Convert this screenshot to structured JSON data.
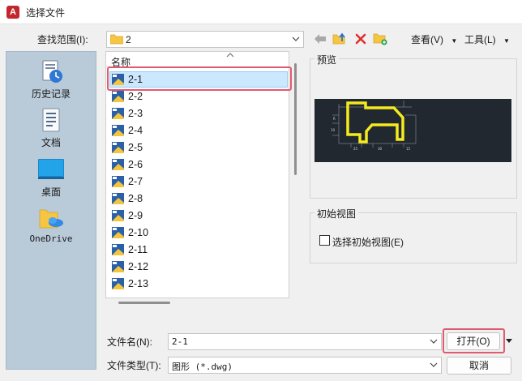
{
  "window": {
    "title": "选择文件",
    "app_icon_letter": "A"
  },
  "lookin": {
    "label": "查找范围(I):",
    "value": "2"
  },
  "toolbar": {
    "view_label": "查看(V)",
    "tools_label": "工具(L)"
  },
  "places": [
    {
      "label": "历史记录",
      "icon": "history-icon"
    },
    {
      "label": "文档",
      "icon": "documents-icon"
    },
    {
      "label": "桌面",
      "icon": "desktop-icon"
    },
    {
      "label": "OneDrive",
      "icon": "onedrive-icon"
    }
  ],
  "filelist": {
    "header": "名称",
    "items": [
      "2-1",
      "2-2",
      "2-3",
      "2-4",
      "2-5",
      "2-6",
      "2-7",
      "2-8",
      "2-9",
      "2-10",
      "2-11",
      "2-12",
      "2-13"
    ],
    "selected": "2-1"
  },
  "preview": {
    "label": "预览"
  },
  "initial_view": {
    "label": "初始视图",
    "checkbox_label": "选择初始视图(E)",
    "checked": false
  },
  "filename": {
    "label": "文件名(N):",
    "value": "2-1"
  },
  "filetype": {
    "label": "文件类型(T):",
    "value": "图形 (*.dwg)"
  },
  "buttons": {
    "open": "打开(O)",
    "cancel": "取消"
  },
  "colors": {
    "accent_highlight": "#e05b6f",
    "selection": "#cce8ff",
    "places_bg": "#b9cad9",
    "preview_bg": "#212830",
    "drawing_line": "#f5ea1d"
  }
}
